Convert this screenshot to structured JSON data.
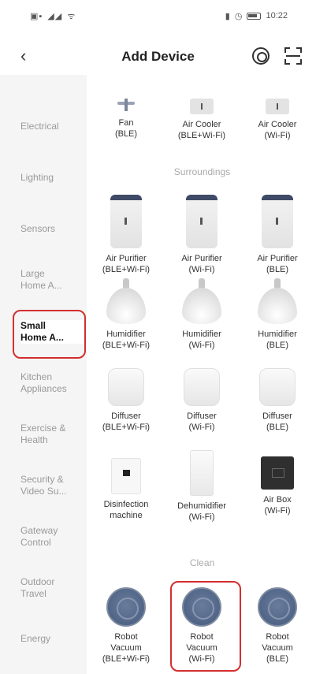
{
  "status": {
    "time": "10:22"
  },
  "header": {
    "title": "Add Device",
    "back_icon": "chevron-left-icon",
    "radar_icon": "radar-icon",
    "scan_icon": "scan-icon"
  },
  "sidebar": {
    "items": [
      {
        "label": "Electrical"
      },
      {
        "label": "Lighting"
      },
      {
        "label": "Sensors"
      },
      {
        "label": "Large\nHome A..."
      },
      {
        "label": "Small\nHome A...",
        "selected": true
      },
      {
        "label": "Kitchen\nAppliances"
      },
      {
        "label": "Exercise &\nHealth"
      },
      {
        "label": "Security &\nVideo Su..."
      },
      {
        "label": "Gateway\nControl"
      },
      {
        "label": "Outdoor\nTravel"
      },
      {
        "label": "Energy"
      }
    ],
    "highlight_color": "#d32f2f"
  },
  "sections": {
    "surroundings": "Surroundings",
    "clean": "Clean"
  },
  "devices": [
    {
      "name": "Fan\n(BLE)",
      "icon": "fan-icon"
    },
    {
      "name": "Air Cooler\n(BLE+Wi-Fi)",
      "icon": "air-cooler-icon"
    },
    {
      "name": "Air Cooler\n(Wi-Fi)",
      "icon": "air-cooler-icon"
    },
    {
      "name": "Air Purifier\n(BLE+Wi-Fi)",
      "icon": "air-purifier-icon"
    },
    {
      "name": "Air Purifier\n(Wi-Fi)",
      "icon": "air-purifier-icon"
    },
    {
      "name": "Air Purifier\n(BLE)",
      "icon": "air-purifier-icon"
    },
    {
      "name": "Humidifier\n(BLE+Wi-Fi)",
      "icon": "humidifier-icon"
    },
    {
      "name": "Humidifier\n(Wi-Fi)",
      "icon": "humidifier-icon"
    },
    {
      "name": "Humidifier\n(BLE)",
      "icon": "humidifier-icon"
    },
    {
      "name": "Diffuser\n(BLE+Wi-Fi)",
      "icon": "diffuser-icon"
    },
    {
      "name": "Diffuser\n(Wi-Fi)",
      "icon": "diffuser-icon"
    },
    {
      "name": "Diffuser\n(BLE)",
      "icon": "diffuser-icon"
    },
    {
      "name": "Disinfection\nmachine",
      "icon": "disinfection-machine-icon"
    },
    {
      "name": "Dehumidifier\n(Wi-Fi)",
      "icon": "dehumidifier-icon"
    },
    {
      "name": "Air Box\n(Wi-Fi)",
      "icon": "air-box-icon"
    },
    {
      "name": "Robot\nVacuum\n(BLE+Wi-Fi)",
      "icon": "robot-vacuum-icon"
    },
    {
      "name": "Robot\nVacuum\n(Wi-Fi)",
      "icon": "robot-vacuum-icon",
      "highlighted": true
    },
    {
      "name": "Robot\nVacuum\n(BLE)",
      "icon": "robot-vacuum-icon"
    }
  ]
}
